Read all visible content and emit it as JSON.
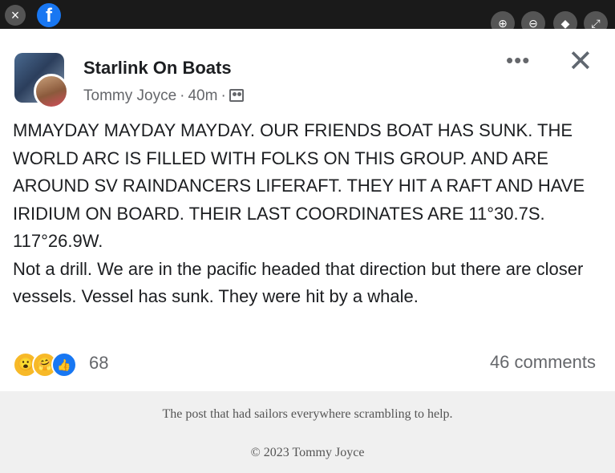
{
  "topbar": {
    "close_icon": "×",
    "brand_icon": "f",
    "tools": [
      "⊕",
      "⊖",
      "◆",
      "⤢"
    ]
  },
  "post": {
    "group_name": "Starlink On Boats",
    "author": "Tommy Joyce",
    "time": "40m",
    "more_icon": "•••",
    "close_icon": "✕",
    "paragraphs": [
      "MMAYDAY MAYDAY MAYDAY. OUR FRIENDS BOAT HAS SUNK. THE WORLD ARC IS FILLED WITH FOLKS ON THIS GROUP. AND ARE AROUND SV RAINDANCERS LIFERAFT. THEY HIT A RAFT AND HAVE IRIDIUM ON BOARD. THEIR LAST COORDINATES ARE 11°30.7S. 117°26.9W.",
      "Not a drill. We are in the pacific headed that direction but there are closer vessels. Vessel has sunk. They were hit by a whale."
    ],
    "reaction_count": "68",
    "comments": "46 comments"
  },
  "caption": "The post that had sailors everywhere scrambling to help.",
  "copyright": "© 2023 Tommy Joyce",
  "colors": {
    "facebook_blue": "#1877f2",
    "meta_gray": "#65676b",
    "topbar": "#1a1a1a"
  }
}
